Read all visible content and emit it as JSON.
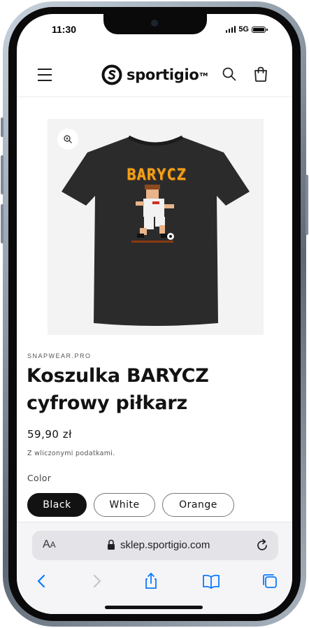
{
  "status_bar": {
    "time": "11:30",
    "network": "5G"
  },
  "header": {
    "logo_text": "sportigio",
    "logo_tm": "TM",
    "icons": [
      "menu-icon",
      "search-icon",
      "cart-icon"
    ]
  },
  "product": {
    "shirt_print_text": "BARYCZ",
    "vendor": "SNAPWEAR.PRO",
    "title": "Koszulka BARYCZ cyfrowy piłkarz",
    "price": "59,90 zł",
    "tax_note": "Z wliczonymi podatkami.",
    "color_label": "Color",
    "colors": [
      {
        "label": "Black",
        "selected": true
      },
      {
        "label": "White",
        "selected": false
      },
      {
        "label": "Orange",
        "selected": false
      }
    ]
  },
  "browser": {
    "aa_label_big": "A",
    "aa_label_small": "A",
    "url": "sklep.sportigio.com",
    "toolbar_icons": [
      "back-icon",
      "forward-icon",
      "share-icon",
      "bookmarks-icon",
      "tabs-icon"
    ]
  },
  "colors": {
    "accent": "#121212",
    "shirt": "#2b2b2b",
    "print_gold": "#f0a21a"
  }
}
